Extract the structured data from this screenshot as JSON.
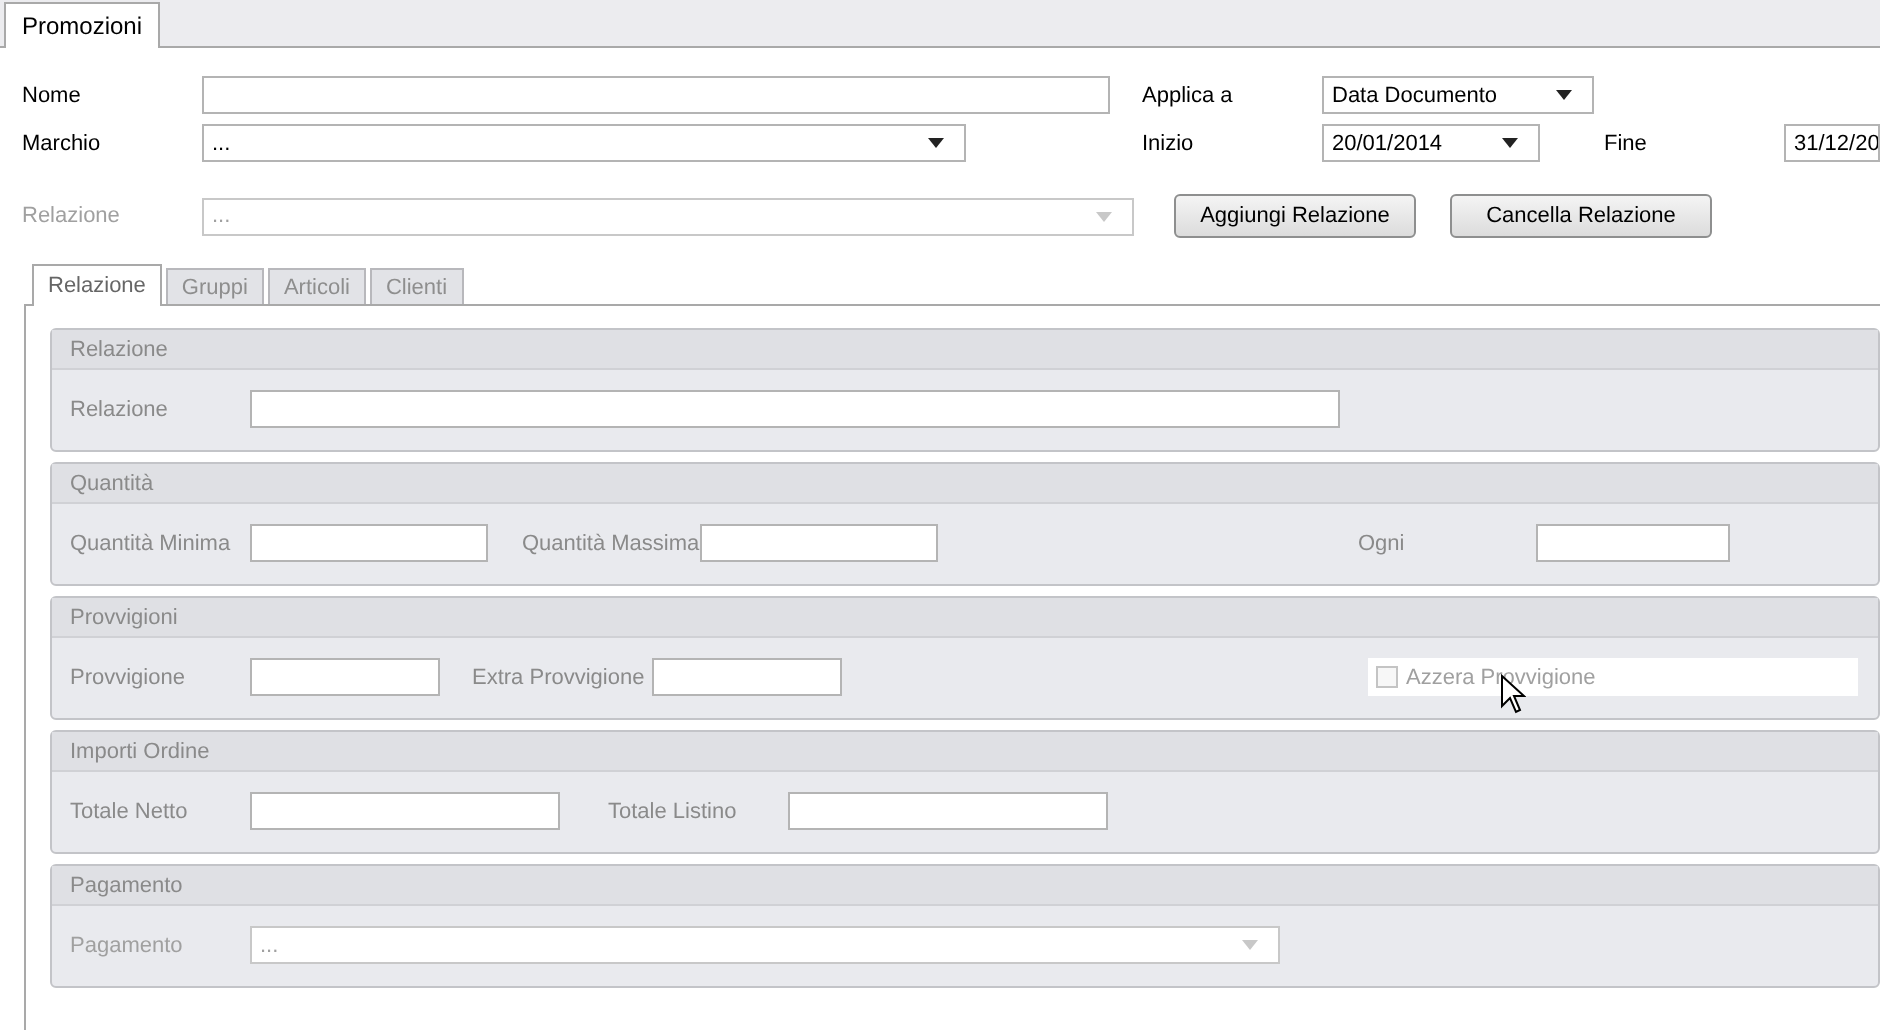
{
  "top_tabs": [
    {
      "label": "Promozioni",
      "selected": true
    }
  ],
  "header_rows": [
    [
      {
        "kind": "text",
        "label": "Nome",
        "disabled": false
      },
      {
        "kind": "combo",
        "label": "Applica a",
        "value": "Data Documento",
        "disabled": false
      }
    ],
    [
      {
        "kind": "combo",
        "label": "Marchio",
        "value": "...",
        "disabled": false
      },
      {
        "kind": "combo",
        "label": "Inizio",
        "value": "20/01/2014",
        "disabled": false
      },
      {
        "kind": "text",
        "label": "Fine",
        "value": "31/12/20",
        "disabled": false
      }
    ],
    [
      {
        "kind": "combo",
        "label": "Relazione",
        "value": "...",
        "disabled": true
      },
      {
        "kind": "button",
        "label": "Aggiungi Relazione",
        "disabled": false
      },
      {
        "kind": "button",
        "label": "Cancella Relazione",
        "disabled": false
      }
    ]
  ],
  "inner_tabs": [
    {
      "label": "Relazione",
      "selected": true
    },
    {
      "label": "Gruppi",
      "selected": false
    },
    {
      "label": "Articoli",
      "selected": false
    },
    {
      "label": "Clienti",
      "selected": false
    }
  ],
  "groups": [
    {
      "title": "Relazione",
      "fields": [
        {
          "kind": "text",
          "label": "Relazione",
          "disabled": false
        }
      ]
    },
    {
      "title": "Quantità",
      "fields": [
        {
          "kind": "text",
          "label": "Quantità Minima",
          "disabled": false
        },
        {
          "kind": "text",
          "label": "Quantità Massima",
          "disabled": false
        },
        {
          "kind": "text",
          "label": "Ogni",
          "disabled": false
        }
      ]
    },
    {
      "title": "Provvigioni",
      "fields": [
        {
          "kind": "text",
          "label": "Provvigione",
          "disabled": false
        },
        {
          "kind": "text",
          "label": "Extra Provvigione",
          "disabled": false
        },
        {
          "kind": "checkbox",
          "label": "Azzera Provvigione",
          "checked": false,
          "disabled": true
        }
      ]
    },
    {
      "title": "Importi Ordine",
      "fields": [
        {
          "kind": "text",
          "label": "Totale Netto",
          "disabled": false
        },
        {
          "kind": "text",
          "label": "Totale Listino",
          "disabled": false
        }
      ]
    },
    {
      "title": "Pagamento",
      "fields": [
        {
          "kind": "combo",
          "label": "Pagamento",
          "value": "...",
          "disabled": true
        }
      ]
    }
  ]
}
